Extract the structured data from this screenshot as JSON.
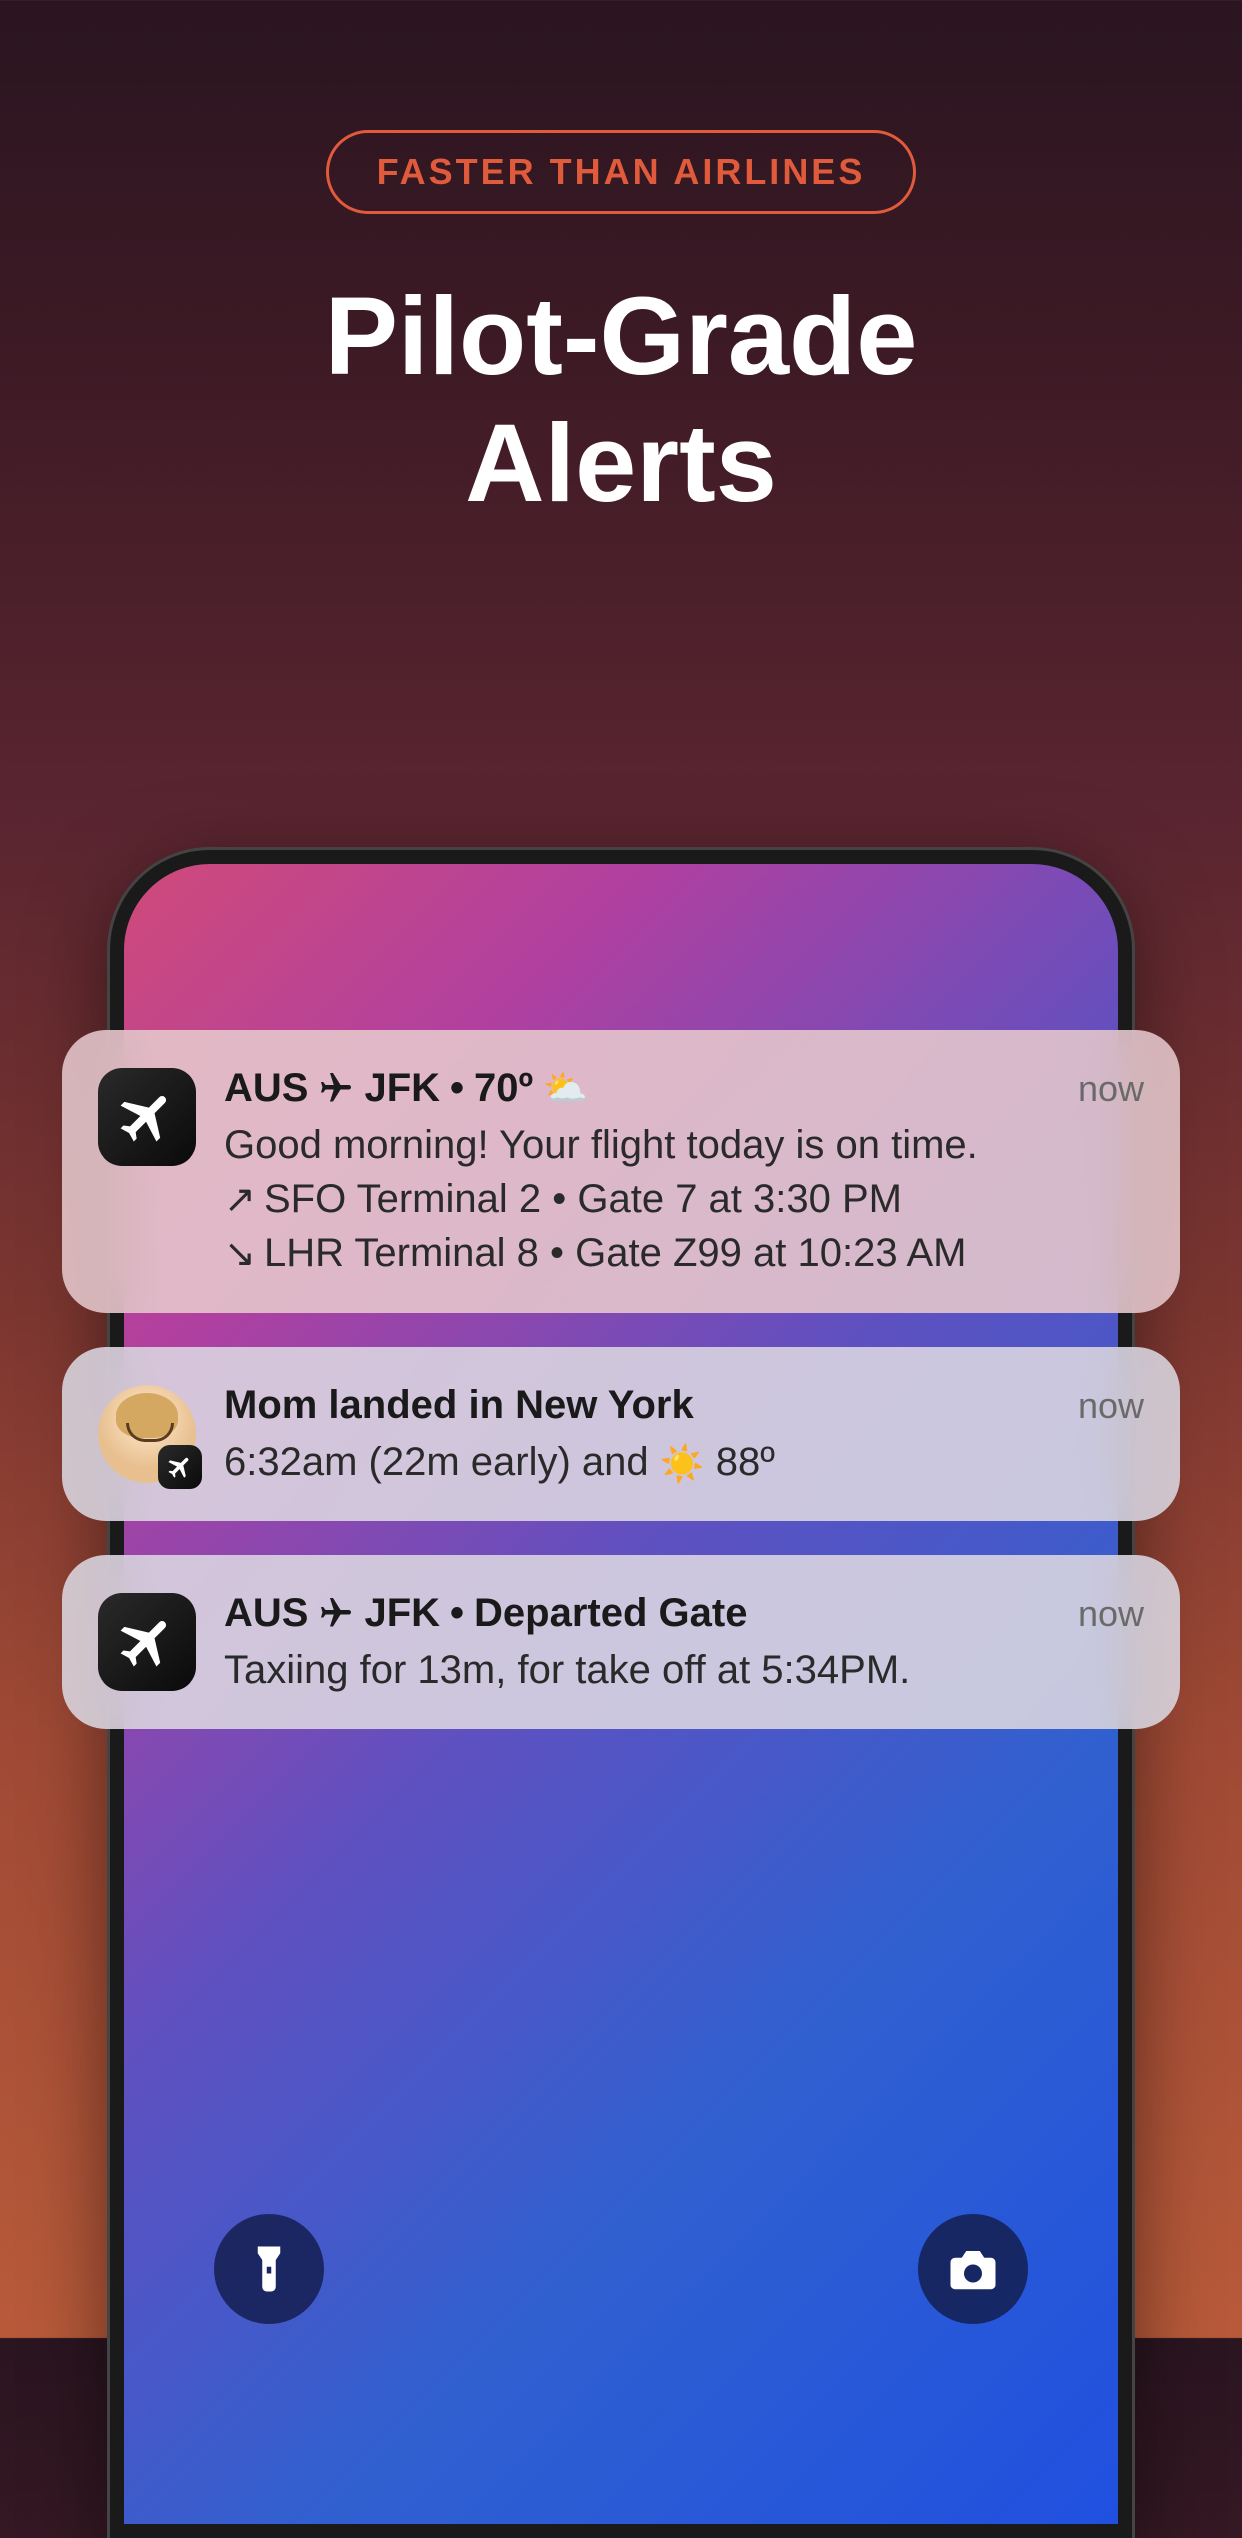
{
  "badge": "FASTER THAN AIRLINES",
  "headline": "Pilot-Grade\nAlerts",
  "notifications": [
    {
      "icon": "app",
      "title_parts": {
        "from": "AUS",
        "to": "JFK",
        "temp": "70º",
        "weather_icon": "⛅"
      },
      "time": "now",
      "body_l1": "Good morning! Your flight today is on time.",
      "dep_arrow": "↗",
      "dep": "SFO Terminal 2 • Gate 7 at 3:30 PM",
      "arr_arrow": "↘",
      "arr": "LHR Terminal 8 • Gate Z99 at 10:23 AM"
    },
    {
      "icon": "avatar",
      "title": "Mom landed in New York",
      "time": "now",
      "body_prefix": "6:32am (22m early) and ",
      "body_weather_icon": "☀️",
      "body_suffix": " 88º"
    },
    {
      "icon": "app",
      "title_parts": {
        "from": "AUS",
        "to": "JFK",
        "status": "Departed Gate"
      },
      "time": "now",
      "body": "Taxiing for 13m, for take off at 5:34PM."
    }
  ],
  "lock_controls": {
    "flashlight": "flashlight",
    "camera": "camera"
  }
}
